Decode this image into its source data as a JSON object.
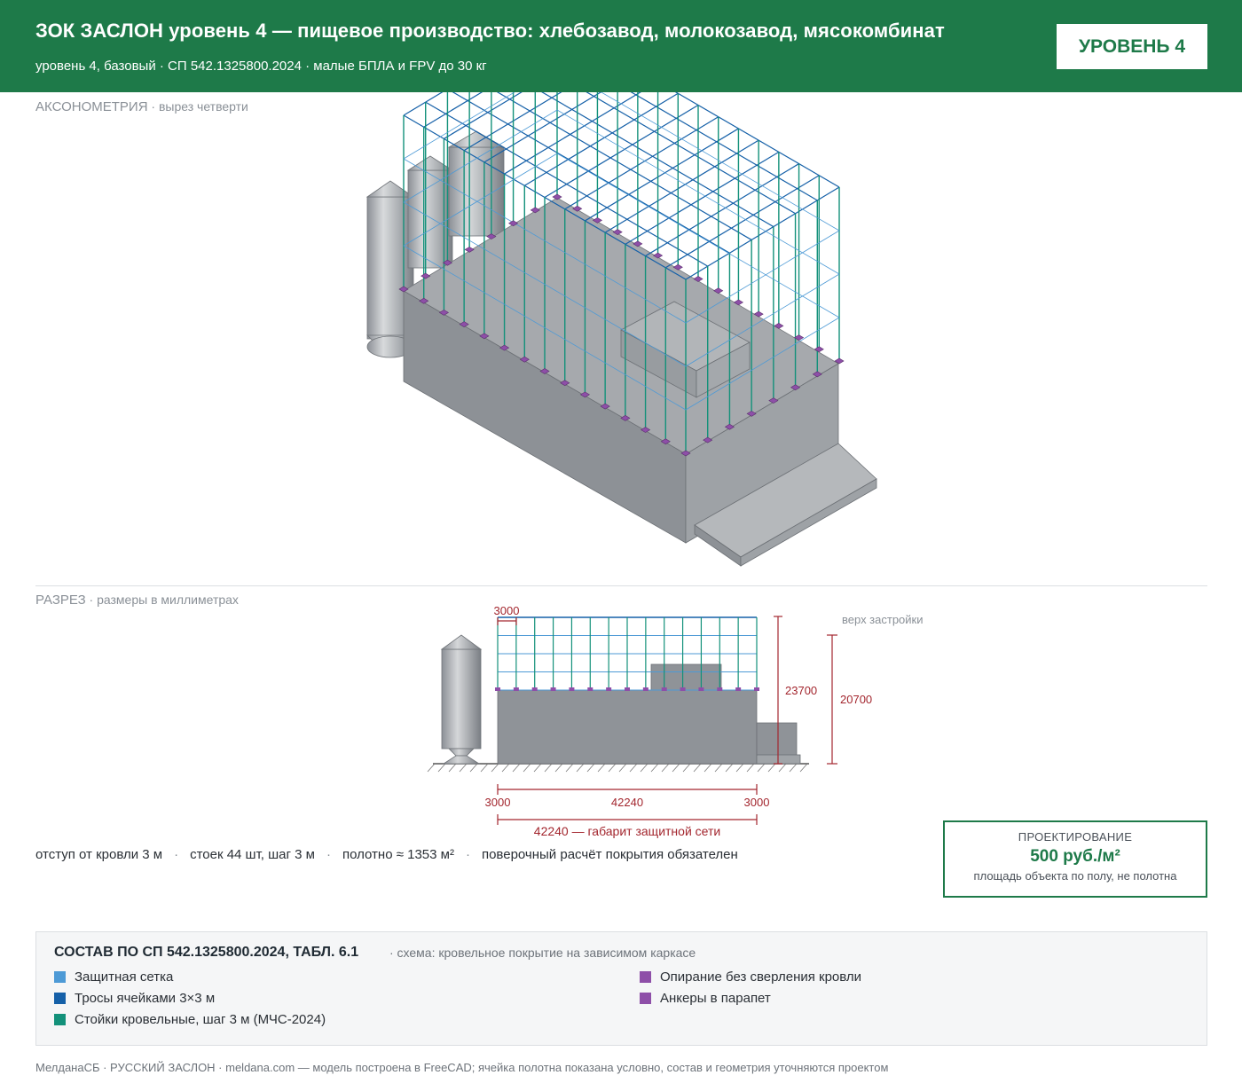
{
  "header": {
    "title": "ЗОК ЗАСЛОН уровень 4 — пищевое производство: хлебозавод, молокозавод, мясокомбинат",
    "subtitle": "уровень 4, базовый · СП 542.1325800.2024 · малые БПЛА и FPV до 30 кг",
    "level_button": "УРОВЕНЬ 4"
  },
  "axo": {
    "label_main": "АКСОНОМЕТРИЯ",
    "label_sub": " · вырез четверти"
  },
  "section": {
    "label_main": "РАЗРЕЗ",
    "label_sub": " · размеры в миллиметрах",
    "dim_cell": "3000",
    "dim_top": "верх застройки",
    "dim_height_total": "23700",
    "dim_height_building": "20700",
    "dim_left": "3000",
    "dim_mid": "42240",
    "dim_right": "3000",
    "dim_overall": "42240 — габарит защитной сети"
  },
  "stats": [
    "отступ от кровли 3 м",
    "стоек 44 шт, шаг 3 м",
    "полотно ≈ 1353 м²",
    "поверочный расчёт покрытия обязателен"
  ],
  "stats_separator": "·",
  "price": {
    "label": "ПРОЕКТИРОВАНИЕ",
    "value": "500 руб./м²",
    "note": "площадь объекта по полу, не полотна"
  },
  "legend": {
    "heading": "СОСТАВ ПО СП 542.1325800.2024, ТАБЛ. 6.1",
    "scheme": " · схема: кровельное покрытие на зависимом каркасе",
    "items": [
      {
        "label": "Защитная сетка",
        "color": "#4d9ad6"
      },
      {
        "label": "Тросы ячейками 3×3 м",
        "color": "#1560a8"
      },
      {
        "label": "Стойки кровельные, шаг 3 м (МЧС-2024)",
        "color": "#13917a"
      },
      {
        "label": "Опирание без сверления кровли",
        "color": "#8e4fa8"
      },
      {
        "label": "Анкеры в парапет",
        "color": "#8e4fa8"
      }
    ]
  },
  "footer": "МелданаСБ · РУССКИЙ ЗАСЛОН · meldana.com — модель построена в FreeCAD; ячейка полотна показана условно, состав и геометрия уточняются проектом"
}
